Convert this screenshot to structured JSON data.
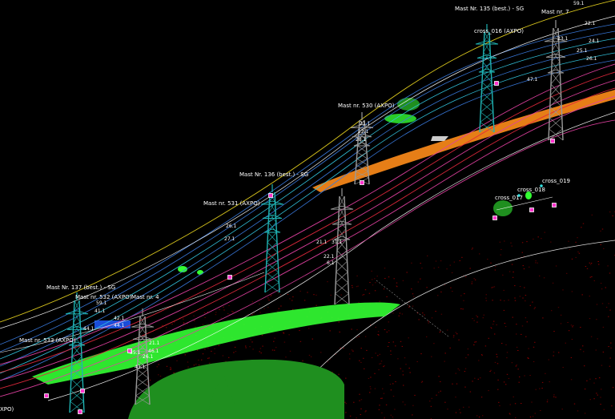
{
  "labels": {
    "mast_135": "Mast Nr. 135 (best.) - SG",
    "mast_7": "Mast nr. 7",
    "cross_016": "cross_016 (AXPO)",
    "mast_530": "Mast nr. 530 (AXPO)",
    "mast_136": "Mast Nr. 136 (best.) - SG",
    "mast_531": "Mast nr. 531 (AXPO)",
    "mast_137": "Mast Nr. 137 (best.) - SG",
    "mast_532": "Mast nr. 532 (AXPO)",
    "mast_4": "Mast nr. 4",
    "mast_533": "Mast nr. 533 (AXPO)",
    "cross_017": "cross_017",
    "cross_018": "cross_018",
    "cross_019": "cross_019",
    "edge_left": "XPO)"
  },
  "tags": [
    "59.1",
    "22.1",
    "23.1",
    "24.1",
    "25.1",
    "26.1",
    "47.1",
    "21.1",
    "22.1",
    "28.1",
    "27.1",
    "26.1",
    "21.1",
    "22.1",
    "31.1",
    "6.1",
    "59.1",
    "41.1",
    "42.1",
    "44.1",
    "46.1",
    "26.1",
    "43.1",
    "21.1",
    "35.1",
    "44.1"
  ],
  "colors": {
    "background": "#000000",
    "pylon_cyan": "#1fb3b3",
    "pylon_grey": "#9a9a9a",
    "vegetation_bright": "#33ff33",
    "vegetation_dark": "#1f8f1f",
    "terrain_red": "#8b0000",
    "road_orange": "#ff8c1a",
    "wire_white": "#ffffff",
    "wire_yellow": "#e6d21f",
    "wire_blue": "#3a7be0",
    "wire_red": "#e0283c",
    "wire_magenta": "#e040a0",
    "wire_cyan": "#33c6e0"
  }
}
